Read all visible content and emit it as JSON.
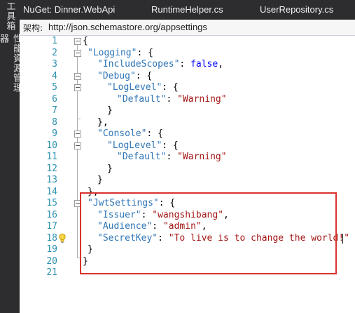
{
  "side_tabs": [
    "工具箱",
    "性能資源管理器"
  ],
  "tabs": [
    {
      "label": "NuGet: Dinner.WebApi",
      "active": true
    },
    {
      "label": "RuntimeHelper.cs",
      "active": false
    },
    {
      "label": "UserRepository.cs",
      "active": false
    }
  ],
  "navbar": {
    "label": "架构:",
    "url": "http://json.schemastore.org/appsettings"
  },
  "lines": [
    "1",
    "2",
    "3",
    "4",
    "5",
    "6",
    "7",
    "8",
    "9",
    "10",
    "11",
    "12",
    "13",
    "14",
    "15",
    "16",
    "17",
    "18",
    "19",
    "20",
    "21"
  ],
  "code": {
    "l1_open": "{",
    "logging_key": "\"Logging\"",
    "include_scopes_key": "\"IncludeScopes\"",
    "false_value": "false",
    "debug_key": "\"Debug\"",
    "loglevel_key": "\"LogLevel\"",
    "default_key": "\"Default\"",
    "warning_value": "\"Warning\"",
    "console_key": "\"Console\"",
    "jwt_key": "\"JwtSettings\"",
    "issuer_key": "\"Issuer\"",
    "issuer_value": "\"wangshibang\"",
    "audience_key": "\"Audience\"",
    "audience_value": "\"admin\"",
    "secret_key": "\"SecretKey\"",
    "secret_value": "\"To live is to change the world!\"",
    "colon": ": ",
    "colon_brace": ": {",
    "comma": ",",
    "close_brace": "}",
    "close_brace_comma": "},"
  },
  "colors": {
    "highlight_box": "#d9322e",
    "line_number": "#2b91af",
    "property": "#2e75b6",
    "string": "#a31515",
    "keyword": "#0000ff"
  }
}
